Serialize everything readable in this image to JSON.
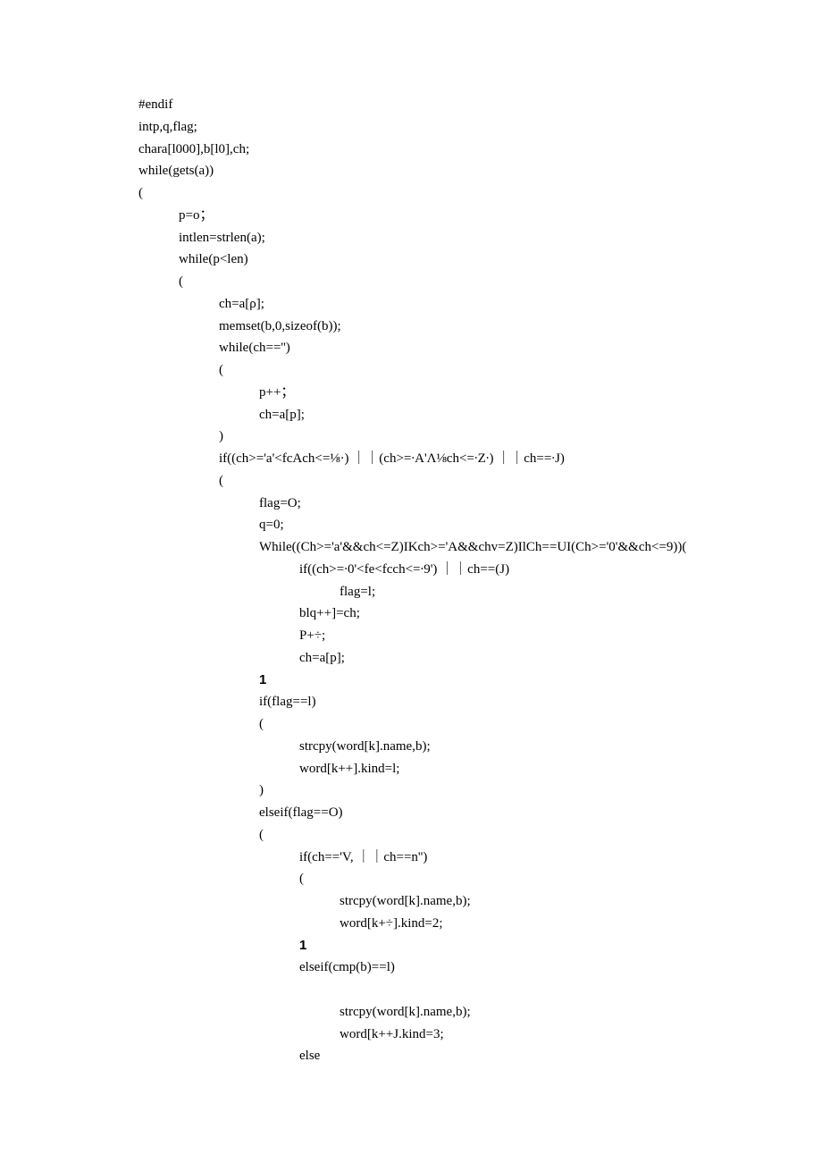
{
  "lines": [
    {
      "indent": 0,
      "text": "#endif"
    },
    {
      "indent": 0,
      "text": "intp,q,flag;"
    },
    {
      "indent": 0,
      "text": "chara[l000],b[l0],ch;"
    },
    {
      "indent": 0,
      "text": "while(gets(a))"
    },
    {
      "indent": 0,
      "text": "("
    },
    {
      "indent": 1,
      "text": "p=o；"
    },
    {
      "indent": 1,
      "text": "intlen=strlen(a);"
    },
    {
      "indent": 1,
      "text": "while(p<len)"
    },
    {
      "indent": 1,
      "text": "("
    },
    {
      "indent": 2,
      "text": "ch=a[ρ];"
    },
    {
      "indent": 2,
      "text": "memset(b,0,sizeof(b));"
    },
    {
      "indent": 2,
      "text": "while(ch=='')"
    },
    {
      "indent": 2,
      "text": "("
    },
    {
      "indent": 3,
      "text": "p++；"
    },
    {
      "indent": 3,
      "text": "ch=a[p];"
    },
    {
      "indent": 2,
      "text": ")"
    },
    {
      "indent": 2,
      "text": "if((ch>='a'<fcAch<=⅛·) ｜｜(ch>=∙A'Λ⅛ch<=∙Z∙) ｜｜ch==∙J)"
    },
    {
      "indent": 2,
      "text": "("
    },
    {
      "indent": 3,
      "text": "flag=O;"
    },
    {
      "indent": 3,
      "text": "q=0;"
    },
    {
      "indent": 3,
      "text": "While((Ch>='a'&&ch<=Z)IKch>='A&&chv=Z)IlCh==UI(Ch>='0'&&ch<=9))("
    },
    {
      "indent": 4,
      "text": "if((ch>=∙0'<fe<fcch<=∙9') ｜｜ch==(J)"
    },
    {
      "indent": 5,
      "text": "flag=l;"
    },
    {
      "indent": 4,
      "text": "blq++]=ch;"
    },
    {
      "indent": 4,
      "text": "P+÷;"
    },
    {
      "indent": 4,
      "text": "ch=a[p];"
    },
    {
      "indent": 3,
      "text": "1",
      "bold": true
    },
    {
      "indent": 3,
      "text": "if(flag==l)"
    },
    {
      "indent": 3,
      "text": "("
    },
    {
      "indent": 4,
      "text": "strcpy(word[k].name,b);"
    },
    {
      "indent": 4,
      "text": "word[k++].kind=l;"
    },
    {
      "indent": 3,
      "text": ")"
    },
    {
      "indent": 3,
      "text": "elseif(flag==O)"
    },
    {
      "indent": 3,
      "text": "("
    },
    {
      "indent": 4,
      "text": "if(ch=='V, ｜｜ch==n'')"
    },
    {
      "indent": 4,
      "text": "("
    },
    {
      "indent": 5,
      "text": "strcpy(word[k].name,b);"
    },
    {
      "indent": 5,
      "text": "word[k+÷].kind=2;"
    },
    {
      "indent": 4,
      "text": "1",
      "bold": true
    },
    {
      "indent": 4,
      "text": "elseif(cmp(b)==l)"
    },
    {
      "indent": 4,
      "text": ""
    },
    {
      "indent": 5,
      "text": "strcpy(word[k].name,b);"
    },
    {
      "indent": 5,
      "text": "word[k++J.kind=3;"
    },
    {
      "indent": 4,
      "text": "else"
    }
  ],
  "indent_size": 45
}
